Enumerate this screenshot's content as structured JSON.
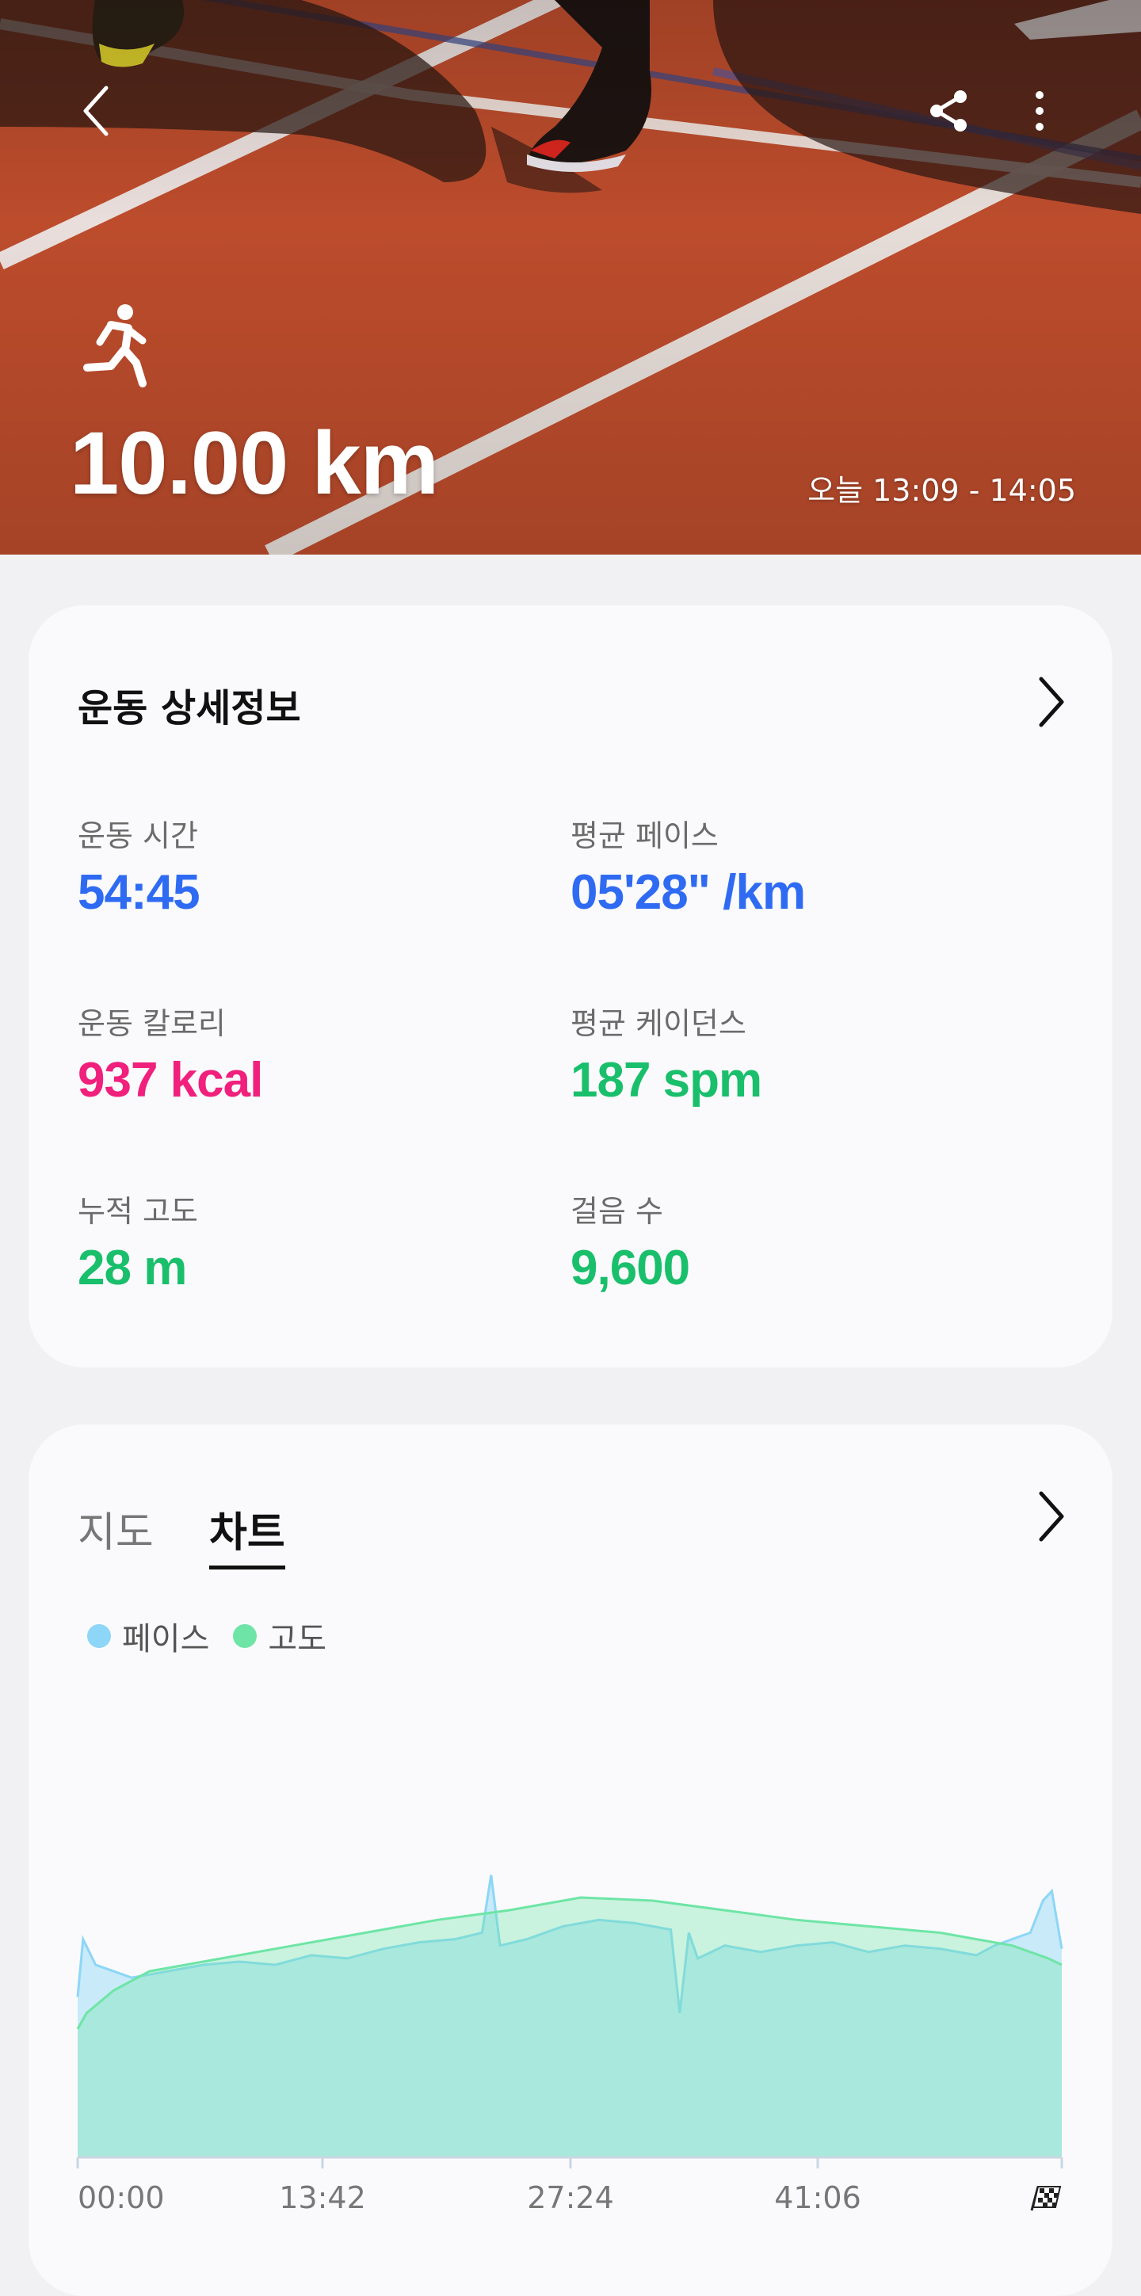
{
  "hero": {
    "distance": "10.00 km",
    "time_range": "오늘 13:09 - 14:05",
    "icons": {
      "back": "back-arrow-icon",
      "share": "share-icon",
      "more": "more-vert-icon",
      "activity": "running-icon"
    }
  },
  "details": {
    "title": "운동 상세정보",
    "stats": [
      {
        "label": "운동 시간",
        "value": "54:45",
        "color": "#2f6bf2"
      },
      {
        "label": "평균 페이스",
        "value": "05'28\" /km",
        "color": "#2f6bf2"
      },
      {
        "label": "운동 칼로리",
        "value": "937 kcal",
        "color": "#f0207c"
      },
      {
        "label": "평균 케이던스",
        "value": "187 spm",
        "color": "#19bf6b"
      },
      {
        "label": "누적 고도",
        "value": "28 m",
        "color": "#19bf6b"
      },
      {
        "label": "걸음 수",
        "value": "9,600",
        "color": "#19bf6b"
      }
    ]
  },
  "chart_card": {
    "tabs": [
      "지도",
      "차트"
    ],
    "active_tab": "차트",
    "legend": [
      {
        "name": "페이스",
        "color": "#8dd6f7"
      },
      {
        "name": "고도",
        "color": "#6ee5a6"
      }
    ],
    "x_ticks": [
      "00:00",
      "13:42",
      "27:24",
      "41:06"
    ],
    "finish_icon": "finish-flag-icon"
  },
  "chart_data": {
    "type": "area",
    "x_ticks": [
      "00:00",
      "13:42",
      "27:24",
      "41:06"
    ],
    "x_range_minutes": [
      0,
      54.75
    ],
    "series": [
      {
        "name": "고도",
        "color": "#6ee5a6",
        "x": [
          0,
          0.5,
          2,
          4,
          8,
          12,
          16,
          20,
          24,
          28,
          32,
          36,
          40,
          44,
          48,
          50,
          52,
          53,
          54,
          54.75
        ],
        "values": [
          40,
          45,
          52,
          58,
          62,
          66,
          70,
          74,
          77,
          81,
          80,
          77,
          74,
          72,
          70,
          68,
          66,
          64,
          62,
          60
        ]
      },
      {
        "name": "페이스",
        "color": "#8dd6f7",
        "x": [
          0,
          0.3,
          1,
          2,
          3,
          5,
          7,
          9,
          11,
          13,
          15,
          17,
          19,
          21,
          22.5,
          23,
          23.5,
          25,
          27,
          29,
          31,
          33,
          33.5,
          34,
          34.5,
          36,
          38,
          40,
          42,
          44,
          46,
          48,
          50,
          51,
          52,
          53,
          53.7,
          54.2,
          54.75
        ],
        "values": [
          50,
          68,
          60,
          58,
          56,
          58,
          60,
          61,
          60,
          63,
          62,
          65,
          67,
          68,
          70,
          88,
          66,
          68,
          72,
          74,
          73,
          71,
          45,
          70,
          62,
          66,
          64,
          66,
          67,
          64,
          66,
          65,
          63,
          66,
          68,
          70,
          80,
          83,
          65
        ]
      }
    ]
  }
}
